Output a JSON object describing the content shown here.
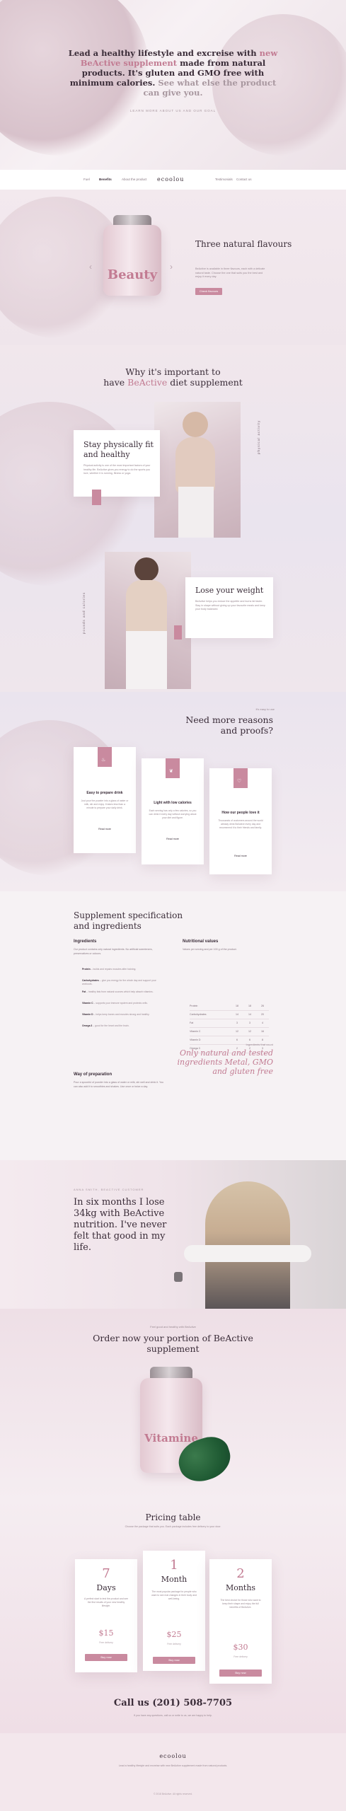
{
  "hero": {
    "line1": "Lead a healthy lifestyle and excreise with",
    "accent1": "new BeActive supplement",
    "line2": " made from natural products. It's gluten and GMO free with minimum calories.",
    "muted": " See what else the product can give you.",
    "sub": "LEARN MORE ABOUT US AND OUR GOAL"
  },
  "nav": {
    "logo": "ecoolou",
    "left": [
      "Fuel",
      "Benefits",
      "About the product"
    ],
    "right": [
      "Testimonials",
      "Contact us"
    ]
  },
  "flavours": {
    "bottle_label": "Beauty",
    "title": "Three natural flavours",
    "text": "BeActive is available in three flavours, each with a delicate natural taste. Choose the one that suits you the best and enjoy it every day.",
    "button": "Check flavours",
    "prev_icon": "chevron-left",
    "next_icon": "chevron-right"
  },
  "why": {
    "title_a": "Why it's important to",
    "title_b": "have ",
    "title_accent": "BeActive",
    "title_c": " diet supplement",
    "card1_title": "Stay physically fit and healthy",
    "card1_text": "Physical activity is one of the most important factors of your healthy life. BeActive gives you energy to do the sports you love, whether it is running, fitness or yoga.",
    "side1": "physical activity",
    "card2_title": "Lose your weight",
    "card2_text": "BeActive helps you reduce the appetite and burns fat faster. Stay in shape without giving up your favourite meals and keep your body balanced.",
    "side2": "pounds and calories"
  },
  "reasons": {
    "kicker": "It's easy to use",
    "title": "Need more reasons and proofs?",
    "cards": [
      {
        "icon": "cup-icon",
        "glyph": "♨",
        "title": "Easy to prepare drink",
        "text": "Just pour the powder into a glass of water or milk, stir and enjoy. It takes less than a minute to prepare your daily drink.",
        "more": "Read more"
      },
      {
        "icon": "leaf-icon",
        "glyph": "❦",
        "title": "Light with low calories",
        "text": "Each serving has only a few calories, so you can drink it every day without worrying about your diet and figure.",
        "more": "Read more"
      },
      {
        "icon": "heart-icon",
        "glyph": "♡",
        "title": "How our people love it",
        "text": "Thousands of customers around the world already drink BeActive every day and recommend it to their friends and family.",
        "more": "Read more"
      }
    ]
  },
  "spec": {
    "title": "Supplement specification and ingredients",
    "ing_h": "Ingredients",
    "ing_p": "Our product contains only natural ingredients. No artificial sweeteners, preservatives or colours.",
    "items": [
      {
        "b": "Protein",
        "t": " – builds and repairs muscles after training."
      },
      {
        "b": "Carbohydrates",
        "t": " – give you energy for the whole day and support your workouts."
      },
      {
        "b": "Fat",
        "t": " – healthy fats from natural sources which help absorb vitamins."
      },
      {
        "b": "Vitamin C",
        "t": " – supports your immune system and protects cells."
      },
      {
        "b": "Vitamin D",
        "t": " – helps keep bones and muscles strong and healthy."
      },
      {
        "b": "Omega 3",
        "t": " – good for the heart and the brain."
      }
    ],
    "prep_h": "Way of preparation",
    "prep_p": "Pour a spoonful of powder into a glass of water or milk, stir well and drink it. You can also add it to smoothies and shakes. Use once or twice a day.",
    "nut_h": "Nutritional values",
    "nut_p": "Values per serving and per 100 g of the product.",
    "nut_rows": [
      {
        "name": "Protein",
        "a": "18",
        "b": "18",
        "c": "26"
      },
      {
        "name": "Carbohydrates",
        "a": "14",
        "b": "14",
        "c": "20"
      },
      {
        "name": "Fat",
        "a": "3",
        "b": "3",
        "c": "4"
      },
      {
        "name": "Vitamin C",
        "a": "12",
        "b": "12",
        "c": "16"
      },
      {
        "name": "Vitamin D",
        "a": "6",
        "b": "6",
        "c": "8"
      },
      {
        "name": "Omega 3",
        "a": "2",
        "b": "2",
        "c": "3"
      }
    ],
    "quote_kicker": "Ingredients that count",
    "quote": "Only natural and tested ingredients Metal, GMO and gluten free"
  },
  "testimonial": {
    "kicker": "ANNA SMITH, BEACTIVE CUSTOMER",
    "quote": "In six months I lose 34kg with BeActive nutrition. I've never felt that good in my life."
  },
  "order": {
    "kicker": "Feel good and healthy with BeActive",
    "title": "Order now your portion of BeActive supplement",
    "bottle_label": "Vitamine"
  },
  "pricing": {
    "title": "Pricing table",
    "sub": "Choose the package that suits you. Each package includes free delivery to your door.",
    "cards": [
      {
        "num": "7",
        "unit": "Days",
        "text": "A perfect start to test the product and see the first results of your new healthy lifestyle.",
        "price": "$15",
        "note": "Free delivery",
        "btn": "Buy now"
      },
      {
        "num": "1",
        "unit": "Month",
        "text": "The most popular package for people who want to see real changes in their body and well-being.",
        "price": "$25",
        "note": "Free delivery",
        "btn": "Buy now"
      },
      {
        "num": "2",
        "unit": "Months",
        "text": "The best choice for those who want to keep their shape and enjoy the full benefits of BeActive.",
        "price": "$30",
        "note": "Free delivery",
        "btn": "Buy now"
      }
    ],
    "call": "Call us (201) 508-7705",
    "call_sub": "If you have any questions, call us or write to us, we are happy to help."
  },
  "footer": {
    "logo": "ecoolou",
    "text": "Lead a healthy lifestyle and excreise with new BeActive supplement made from natural products.",
    "copy": "© 2018 BeActive. All rights reserved."
  },
  "colors": {
    "accent": "#c27b92",
    "button": "#c98a9f",
    "background": "#f6eef2"
  }
}
